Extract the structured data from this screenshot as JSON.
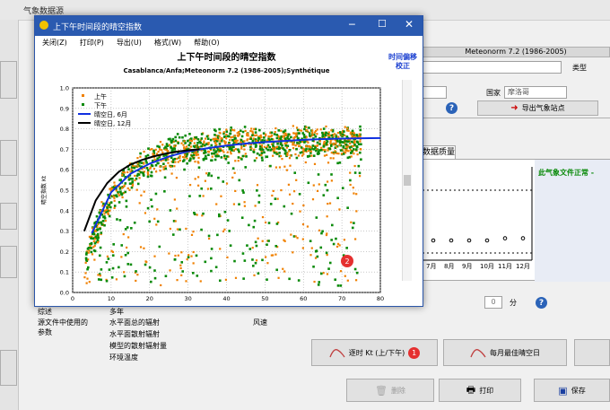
{
  "main": {
    "window_title": "气象数据源",
    "source_label": "Meteonorm 7.2 (1986-2005)",
    "type_label": "类型",
    "country_label": "国家",
    "country_value": "摩洛哥",
    "export_btn": "导出气象站点",
    "tab_quality": "数据质量",
    "quality_status": "此气象文件正常 -",
    "months": [
      "7月",
      "8月",
      "9月",
      "10月",
      "11月",
      "12月"
    ],
    "minutes_value": "0",
    "minutes_unit": "分",
    "left_labels": {
      "label1": "综述",
      "label2": "源文件中使用的参数",
      "value1": "多年",
      "params": [
        "水平面总的辐射",
        "水平面散射辐射",
        "模型的散射辐射量",
        "环境温度"
      ],
      "wind": "风速"
    },
    "btn_kt": "逐时 Kt (上/下午)",
    "btn_kt_badge": "1",
    "btn_best_day": "每月最佳晴空日",
    "btn_delete": "删除",
    "btn_print": "打印",
    "btn_save": "保存"
  },
  "dialog": {
    "title": "上下午时间段的晴空指数",
    "menu": [
      "关闭(Z)",
      "打印(P)",
      "导出(U)",
      "格式(W)",
      "帮助(O)"
    ],
    "time_shift_label": "时间偏移\n校正",
    "badge_text": "2"
  },
  "chart_data": {
    "type": "scatter",
    "title": "上下午时间段的晴空指数",
    "subtitle": "Casablanca/Anfa;Meteonorm 7.2 (1986-2005);Synthétique",
    "xlabel": "太阳高度角 [°]",
    "ylabel": "晴空指数 Kt",
    "xlim": [
      0,
      80
    ],
    "ylim": [
      0,
      1.0
    ],
    "xticks": [
      0,
      10,
      20,
      30,
      40,
      50,
      60,
      70,
      80
    ],
    "yticks": [
      0,
      0.1,
      0.2,
      0.3,
      0.4,
      0.5,
      0.6,
      0.7,
      0.8,
      0.9,
      1.0
    ],
    "grid": true,
    "legend_position": "top-left",
    "series": [
      {
        "name": "上午",
        "kind": "scatter",
        "color": "#f08000"
      },
      {
        "name": "下午",
        "kind": "scatter",
        "color": "#0a8a0a"
      },
      {
        "name": "晴空日, 6月",
        "kind": "line",
        "color": "#1030e0",
        "x": [
          5,
          10,
          15,
          20,
          25,
          30,
          35,
          40,
          45,
          50,
          55,
          60,
          65,
          70,
          75,
          80
        ],
        "y": [
          0.29,
          0.49,
          0.58,
          0.63,
          0.665,
          0.69,
          0.705,
          0.718,
          0.728,
          0.735,
          0.741,
          0.746,
          0.75,
          0.752,
          0.754,
          0.755
        ]
      },
      {
        "name": "晴空日, 12月",
        "kind": "line",
        "color": "#000000",
        "x": [
          3,
          6,
          9,
          12,
          15,
          18,
          21,
          24,
          27,
          30,
          33
        ],
        "y": [
          0.3,
          0.45,
          0.535,
          0.59,
          0.625,
          0.648,
          0.665,
          0.678,
          0.688,
          0.695,
          0.7
        ]
      }
    ]
  },
  "quality_chart": {
    "type": "scatter",
    "categories": [
      "7月",
      "8月",
      "9月",
      "10月",
      "11月",
      "12月"
    ],
    "values": [
      0.3,
      0.3,
      0.3,
      0.3,
      0.31,
      0.31
    ]
  }
}
